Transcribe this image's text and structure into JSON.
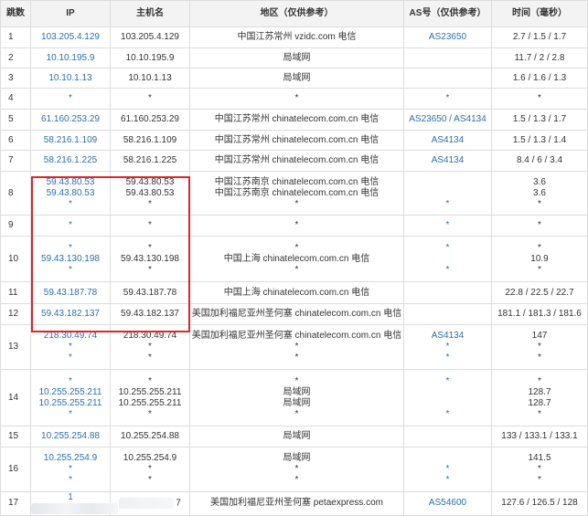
{
  "headers": [
    "跳数",
    "IP",
    "主机名",
    "地区（仅供参考）",
    "AS号（仅供参考）",
    "时间（毫秒）"
  ],
  "rows": [
    {
      "hop": "1",
      "ip": [
        "103.205.4.129"
      ],
      "host": [
        "103.205.4.129"
      ],
      "region": [
        "中国江苏常州 vzidc.com 电信"
      ],
      "asn": [
        "AS23650"
      ],
      "time": [
        "2.7 / 1.5 / 1.7"
      ]
    },
    {
      "hop": "2",
      "ip": [
        "10.10.195.9"
      ],
      "host": [
        "10.10.195.9"
      ],
      "region": [
        "局域网"
      ],
      "asn": [
        ""
      ],
      "time": [
        "11.7 / 2 / 2.8"
      ]
    },
    {
      "hop": "3",
      "ip": [
        "10.10.1.13"
      ],
      "host": [
        "10.10.1.13"
      ],
      "region": [
        "局域网"
      ],
      "asn": [
        ""
      ],
      "time": [
        "1.6 / 1.6 / 1.3"
      ]
    },
    {
      "hop": "4",
      "ip": [
        "*"
      ],
      "host": [
        "*"
      ],
      "region": [
        "*"
      ],
      "asn": [
        "*"
      ],
      "time": [
        "*"
      ]
    },
    {
      "hop": "5",
      "ip": [
        "61.160.253.29"
      ],
      "host": [
        "61.160.253.29"
      ],
      "region": [
        "中国江苏常州 chinatelecom.com.cn 电信"
      ],
      "asn": [
        "AS23650 / AS4134"
      ],
      "time": [
        "1.5 / 1.3 / 1.7"
      ]
    },
    {
      "hop": "6",
      "ip": [
        "58.216.1.109"
      ],
      "host": [
        "58.216.1.109"
      ],
      "region": [
        "中国江苏常州 chinatelecom.com.cn 电信"
      ],
      "asn": [
        "AS4134"
      ],
      "time": [
        "1.5 / 1.3 / 1.4"
      ]
    },
    {
      "hop": "7",
      "ip": [
        "58.216.1.225"
      ],
      "host": [
        "58.216.1.225"
      ],
      "region": [
        "中国江苏常州 chinatelecom.com.cn 电信"
      ],
      "asn": [
        "AS4134"
      ],
      "time": [
        "8.4 / 6 / 3.4"
      ]
    },
    {
      "hop": "8",
      "ip": [
        "59.43.80.53",
        "59.43.80.53",
        "*"
      ],
      "host": [
        "59.43.80.53",
        "59.43.80.53",
        "*"
      ],
      "region": [
        "中国江苏南京 chinatelecom.com.cn 电信",
        "中国江苏南京 chinatelecom.com.cn 电信",
        "*"
      ],
      "asn": [
        "",
        "",
        "*"
      ],
      "time": [
        "3.6",
        "3.6",
        "*"
      ]
    },
    {
      "hop": "9",
      "ip": [
        "*"
      ],
      "host": [
        "*"
      ],
      "region": [
        "*"
      ],
      "asn": [
        "*"
      ],
      "time": [
        "*"
      ]
    },
    {
      "hop": "10",
      "ip": [
        "*",
        "59.43.130.198",
        "*"
      ],
      "host": [
        "*",
        "59.43.130.198",
        "*"
      ],
      "region": [
        "*",
        "中国上海 chinatelecom.com.cn 电信",
        "*"
      ],
      "asn": [
        "*",
        "",
        "*"
      ],
      "time": [
        "*",
        "10.9",
        "*"
      ]
    },
    {
      "hop": "11",
      "ip": [
        "59.43.187.78"
      ],
      "host": [
        "59.43.187.78"
      ],
      "region": [
        "中国上海 chinatelecom.com.cn 电信"
      ],
      "asn": [
        ""
      ],
      "time": [
        "22.8 / 22.5 / 22.7"
      ]
    },
    {
      "hop": "12",
      "ip": [
        "59.43.182.137"
      ],
      "host": [
        "59.43.182.137"
      ],
      "region": [
        "美国加利福尼亚州圣何塞 chinatelecom.com.cn 电信"
      ],
      "asn": [
        ""
      ],
      "time": [
        "181.1 / 181.3 / 181.6"
      ]
    },
    {
      "hop": "13",
      "ip": [
        "218.30.49.74",
        "*",
        "*"
      ],
      "host": [
        "218.30.49.74",
        "*",
        "*"
      ],
      "region": [
        "美国加利福尼亚州圣何塞 chinatelecom.com.cn 电信",
        "*",
        "*"
      ],
      "asn": [
        "AS4134",
        "*",
        "*"
      ],
      "time": [
        "147",
        "*",
        "*"
      ]
    },
    {
      "hop": "14",
      "ip": [
        "*",
        "10.255.255.211",
        "10.255.255.211",
        "*"
      ],
      "host": [
        "*",
        "10.255.255.211",
        "10.255.255.211",
        "*"
      ],
      "region": [
        "*",
        "局域网",
        "局域网",
        "*"
      ],
      "asn": [
        "*",
        "",
        "",
        "*"
      ],
      "time": [
        "*",
        "128.7",
        "128.7",
        "*"
      ]
    },
    {
      "hop": "15",
      "ip": [
        "10.255.254.88"
      ],
      "host": [
        "10.255.254.88"
      ],
      "region": [
        "局域网"
      ],
      "asn": [
        ""
      ],
      "time": [
        "133 / 133.1 / 133.1"
      ]
    },
    {
      "hop": "16",
      "ip": [
        "10.255.254.9",
        "*",
        "*"
      ],
      "host": [
        "10.255.254.9",
        "*",
        "*"
      ],
      "region": [
        "局域网",
        "*",
        "*"
      ],
      "asn": [
        "",
        "*",
        "*"
      ],
      "time": [
        "141.5",
        "*",
        "*"
      ]
    },
    {
      "hop": "17",
      "ip": [
        "1"
      ],
      "host": [
        "7"
      ],
      "region": [
        "美国加利福尼亚州圣何塞 petaexpress.com"
      ],
      "asn": [
        "AS54600"
      ],
      "time": [
        "127.6 / 126.5 / 128"
      ],
      "masked": true
    }
  ],
  "row_heights": [],
  "colors": {
    "link": "#2a6fb0",
    "highlight_border": "#e0262a",
    "header_bg": "#f3f3f3",
    "grid": "#dcdcdc"
  }
}
